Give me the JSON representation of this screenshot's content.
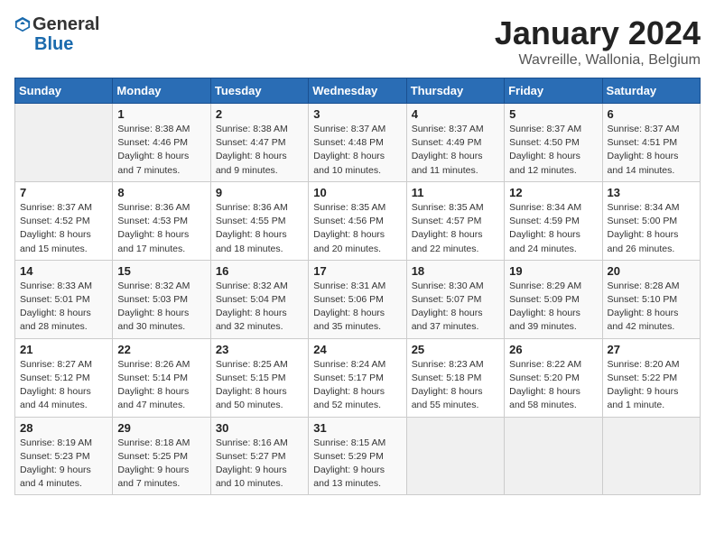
{
  "header": {
    "logo_line1": "General",
    "logo_line2": "Blue",
    "title": "January 2024",
    "subtitle": "Wavreille, Wallonia, Belgium"
  },
  "weekdays": [
    "Sunday",
    "Monday",
    "Tuesday",
    "Wednesday",
    "Thursday",
    "Friday",
    "Saturday"
  ],
  "weeks": [
    [
      {
        "day": null,
        "info": null
      },
      {
        "day": "1",
        "info": "Sunrise: 8:38 AM\nSunset: 4:46 PM\nDaylight: 8 hours\nand 7 minutes."
      },
      {
        "day": "2",
        "info": "Sunrise: 8:38 AM\nSunset: 4:47 PM\nDaylight: 8 hours\nand 9 minutes."
      },
      {
        "day": "3",
        "info": "Sunrise: 8:37 AM\nSunset: 4:48 PM\nDaylight: 8 hours\nand 10 minutes."
      },
      {
        "day": "4",
        "info": "Sunrise: 8:37 AM\nSunset: 4:49 PM\nDaylight: 8 hours\nand 11 minutes."
      },
      {
        "day": "5",
        "info": "Sunrise: 8:37 AM\nSunset: 4:50 PM\nDaylight: 8 hours\nand 12 minutes."
      },
      {
        "day": "6",
        "info": "Sunrise: 8:37 AM\nSunset: 4:51 PM\nDaylight: 8 hours\nand 14 minutes."
      }
    ],
    [
      {
        "day": "7",
        "info": "Sunrise: 8:37 AM\nSunset: 4:52 PM\nDaylight: 8 hours\nand 15 minutes."
      },
      {
        "day": "8",
        "info": "Sunrise: 8:36 AM\nSunset: 4:53 PM\nDaylight: 8 hours\nand 17 minutes."
      },
      {
        "day": "9",
        "info": "Sunrise: 8:36 AM\nSunset: 4:55 PM\nDaylight: 8 hours\nand 18 minutes."
      },
      {
        "day": "10",
        "info": "Sunrise: 8:35 AM\nSunset: 4:56 PM\nDaylight: 8 hours\nand 20 minutes."
      },
      {
        "day": "11",
        "info": "Sunrise: 8:35 AM\nSunset: 4:57 PM\nDaylight: 8 hours\nand 22 minutes."
      },
      {
        "day": "12",
        "info": "Sunrise: 8:34 AM\nSunset: 4:59 PM\nDaylight: 8 hours\nand 24 minutes."
      },
      {
        "day": "13",
        "info": "Sunrise: 8:34 AM\nSunset: 5:00 PM\nDaylight: 8 hours\nand 26 minutes."
      }
    ],
    [
      {
        "day": "14",
        "info": "Sunrise: 8:33 AM\nSunset: 5:01 PM\nDaylight: 8 hours\nand 28 minutes."
      },
      {
        "day": "15",
        "info": "Sunrise: 8:32 AM\nSunset: 5:03 PM\nDaylight: 8 hours\nand 30 minutes."
      },
      {
        "day": "16",
        "info": "Sunrise: 8:32 AM\nSunset: 5:04 PM\nDaylight: 8 hours\nand 32 minutes."
      },
      {
        "day": "17",
        "info": "Sunrise: 8:31 AM\nSunset: 5:06 PM\nDaylight: 8 hours\nand 35 minutes."
      },
      {
        "day": "18",
        "info": "Sunrise: 8:30 AM\nSunset: 5:07 PM\nDaylight: 8 hours\nand 37 minutes."
      },
      {
        "day": "19",
        "info": "Sunrise: 8:29 AM\nSunset: 5:09 PM\nDaylight: 8 hours\nand 39 minutes."
      },
      {
        "day": "20",
        "info": "Sunrise: 8:28 AM\nSunset: 5:10 PM\nDaylight: 8 hours\nand 42 minutes."
      }
    ],
    [
      {
        "day": "21",
        "info": "Sunrise: 8:27 AM\nSunset: 5:12 PM\nDaylight: 8 hours\nand 44 minutes."
      },
      {
        "day": "22",
        "info": "Sunrise: 8:26 AM\nSunset: 5:14 PM\nDaylight: 8 hours\nand 47 minutes."
      },
      {
        "day": "23",
        "info": "Sunrise: 8:25 AM\nSunset: 5:15 PM\nDaylight: 8 hours\nand 50 minutes."
      },
      {
        "day": "24",
        "info": "Sunrise: 8:24 AM\nSunset: 5:17 PM\nDaylight: 8 hours\nand 52 minutes."
      },
      {
        "day": "25",
        "info": "Sunrise: 8:23 AM\nSunset: 5:18 PM\nDaylight: 8 hours\nand 55 minutes."
      },
      {
        "day": "26",
        "info": "Sunrise: 8:22 AM\nSunset: 5:20 PM\nDaylight: 8 hours\nand 58 minutes."
      },
      {
        "day": "27",
        "info": "Sunrise: 8:20 AM\nSunset: 5:22 PM\nDaylight: 9 hours\nand 1 minute."
      }
    ],
    [
      {
        "day": "28",
        "info": "Sunrise: 8:19 AM\nSunset: 5:23 PM\nDaylight: 9 hours\nand 4 minutes."
      },
      {
        "day": "29",
        "info": "Sunrise: 8:18 AM\nSunset: 5:25 PM\nDaylight: 9 hours\nand 7 minutes."
      },
      {
        "day": "30",
        "info": "Sunrise: 8:16 AM\nSunset: 5:27 PM\nDaylight: 9 hours\nand 10 minutes."
      },
      {
        "day": "31",
        "info": "Sunrise: 8:15 AM\nSunset: 5:29 PM\nDaylight: 9 hours\nand 13 minutes."
      },
      {
        "day": null,
        "info": null
      },
      {
        "day": null,
        "info": null
      },
      {
        "day": null,
        "info": null
      }
    ]
  ]
}
